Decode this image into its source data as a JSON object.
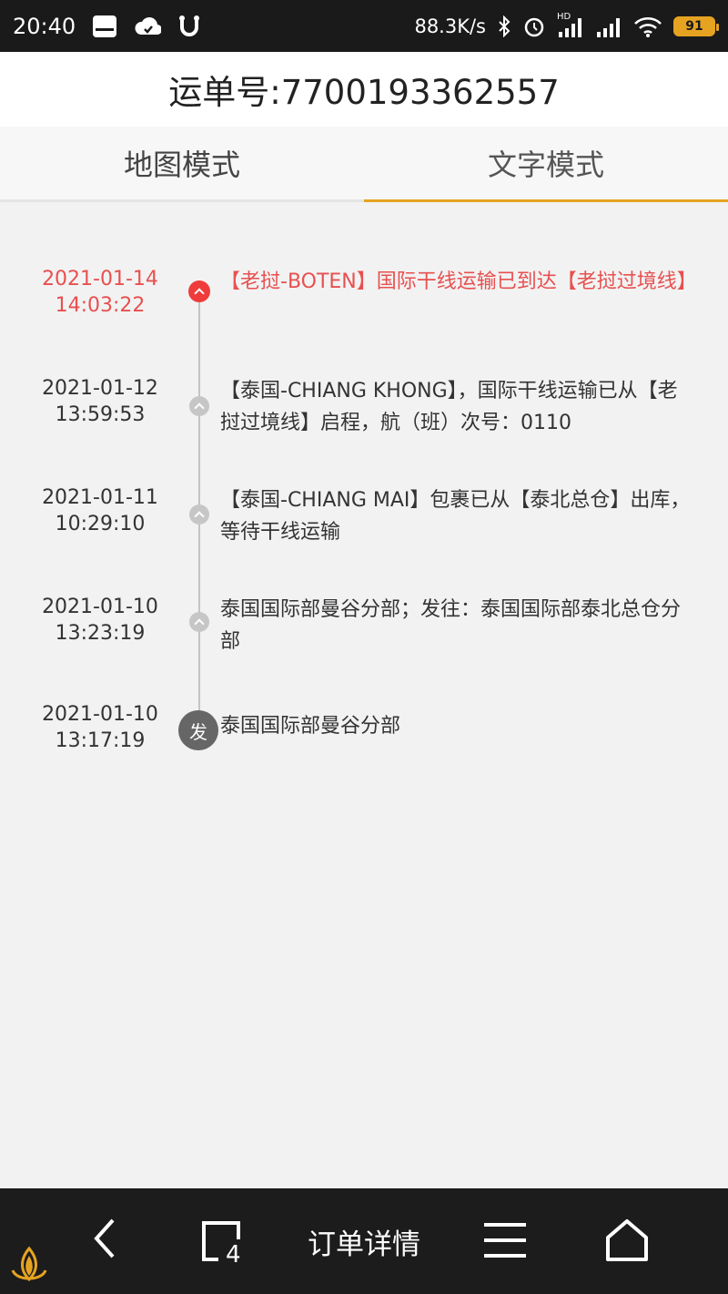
{
  "status_bar": {
    "time": "20:40",
    "net_speed": "88.3K/s",
    "battery": "91",
    "hd_label": "HD"
  },
  "header": {
    "title": "运单号:7700193362557"
  },
  "tabs": [
    {
      "label": "地图模式",
      "active": false
    },
    {
      "label": "文字模式",
      "active": true
    }
  ],
  "timeline": [
    {
      "date": "2021-01-14",
      "time": "14:03:22",
      "desc": "【老挝-BOTEN】国际干线运输已到达【老挝过境线】",
      "current": true
    },
    {
      "date": "2021-01-12",
      "time": "13:59:53",
      "desc": "【泰国-CHIANG KHONG】，国际干线运输已从【老挝过境线】启程，航（班）次号：0110",
      "current": false
    },
    {
      "date": "2021-01-11",
      "time": "10:29:10",
      "desc": "【泰国-CHIANG MAI】包裹已从【泰北总仓】出库，等待干线运输",
      "current": false
    },
    {
      "date": "2021-01-10",
      "time": "13:23:19",
      "desc": "泰国国际部曼谷分部；发往：泰国国际部泰北总仓分部",
      "current": false
    },
    {
      "date": "2021-01-10",
      "time": "13:17:19",
      "desc": "泰国国际部曼谷分部",
      "current": false,
      "start_label": "发"
    }
  ],
  "bottom_nav": {
    "tab_count": "4",
    "title": "订单详情"
  },
  "colors": {
    "accent": "#e6a321",
    "current": "#e85050",
    "node": "#c6c6c6"
  }
}
